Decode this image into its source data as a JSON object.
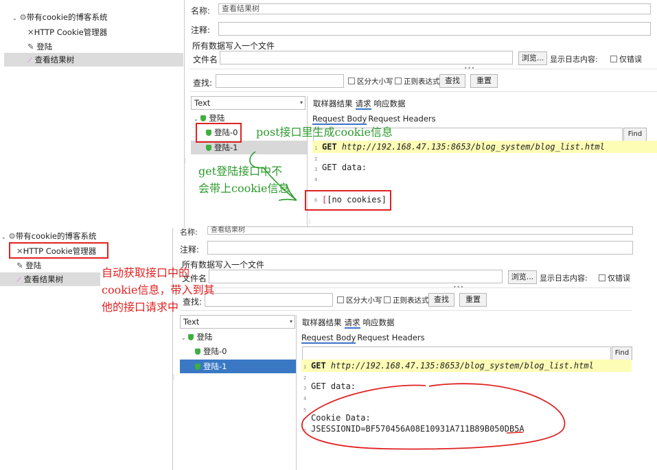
{
  "top": {
    "tree": {
      "root": "带有cookie的博客系统",
      "cookie_manager": "HTTP Cookie管理器",
      "login": "登陆",
      "results_tree": "查看结果树"
    },
    "form": {
      "name_label": "名称:",
      "name_value": "查看结果树",
      "comment_label": "注释:",
      "section_title": "所有数据写入一个文件",
      "filename_label": "文件名",
      "browse_label": "浏览...",
      "log_label": "显示日志内容:",
      "errors_only_label": "仅错误",
      "search_label": "查找:",
      "case_label": "区分大小写",
      "regex_label": "正则表达式",
      "find_btn": "查找",
      "reset_btn": "重置"
    },
    "renderer": "Text",
    "tabs": {
      "sampler": "取样器结果",
      "request": "请求",
      "response": "响应数据"
    },
    "subtabs": {
      "body": "Request Body",
      "headers": "Request Headers"
    },
    "find_label": "Find",
    "results": {
      "parent": "登陆",
      "child0": "登陆-0",
      "child1": "登陆-1"
    },
    "code": {
      "l1_method": "GET",
      "l1_url": "http://192.168.47.135:8653/blog_system/blog_list.html",
      "l3": "GET data:",
      "l6": "[no cookies]"
    },
    "annotations": {
      "post": "post接口里生成cookie信息",
      "get1": "get登陆接口中不",
      "get2": "会带上cookie信息"
    }
  },
  "bottom": {
    "tree": {
      "root": "带有cookie的博客系统",
      "cookie_manager": "HTTP Cookie管理器",
      "login": "登陆",
      "results_tree": "查看结果树"
    },
    "form": {
      "name_label": "名称:",
      "name_value": "查看结果树",
      "comment_label": "注释:",
      "section_title": "所有数据写入一个文件",
      "filename_label": "文件名",
      "browse_label": "浏览...",
      "log_label": "显示日志内容:",
      "errors_only_label": "仅错误",
      "search_label": "查找:",
      "case_label": "区分大小写",
      "regex_label": "正则表达式",
      "find_btn": "查找",
      "reset_btn": "重置"
    },
    "renderer": "Text",
    "tabs": {
      "sampler": "取样器结果",
      "request": "请求",
      "response": "响应数据"
    },
    "subtabs": {
      "body": "Request Body",
      "headers": "Request Headers"
    },
    "find_label": "Find",
    "results": {
      "parent": "登陆",
      "child0": "登陆-0",
      "child1": "登陆-1"
    },
    "code": {
      "l1_method": "GET",
      "l1_url": "http://192.168.47.135:8653/blog_system/blog_list.html",
      "l3": "GET data:",
      "l6": "Cookie Data:",
      "l7": "JSESSIONID=BF570456A08E10931A711B89B050DB5A"
    },
    "annotations": {
      "auto1": "自动获取接口中的",
      "auto2": "cookie信息，带入到其",
      "auto3": "他的接口请求中"
    }
  },
  "line_numbers": [
    "1",
    "2",
    "3",
    "4",
    "5",
    "6",
    "7"
  ],
  "colors": {
    "annotation_red": "#e02020",
    "annotation_green": "#2c9a2c",
    "selection_blue": "#3a78c4",
    "highlight_yellow": "#fdfdb6"
  }
}
